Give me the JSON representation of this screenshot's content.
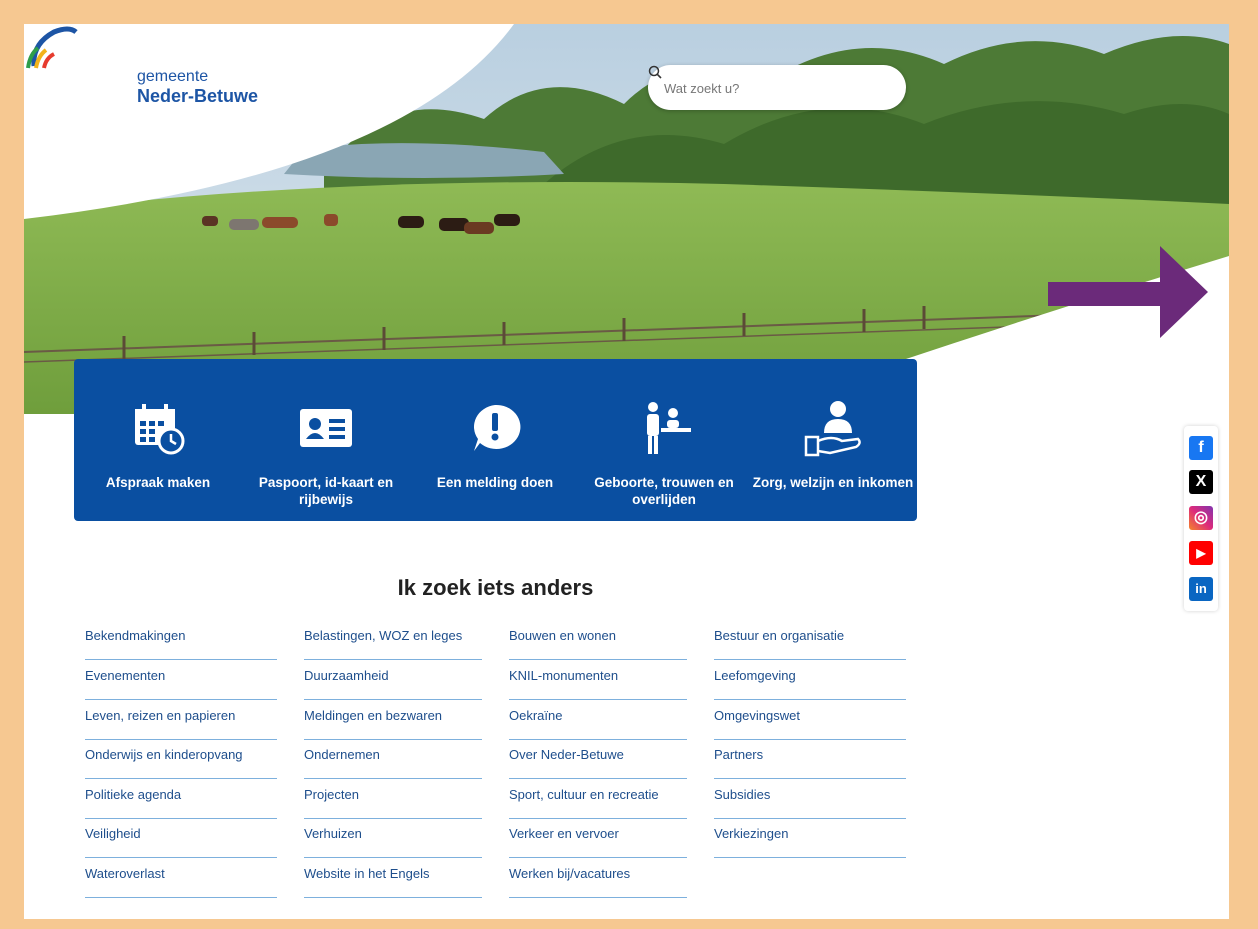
{
  "header": {
    "logo_line1": "gemeente",
    "logo_line2": "Neder-Betuwe",
    "search_placeholder": "Wat zoekt u?"
  },
  "tiles": [
    {
      "label": "Afspraak maken",
      "icon": "calendar-clock-icon"
    },
    {
      "label": "Paspoort, id-kaart en rijbewijs",
      "icon": "id-card-icon"
    },
    {
      "label": "Een melding doen",
      "icon": "exclamation-bubble-icon"
    },
    {
      "label": "Geboorte, trouwen en overlijden",
      "icon": "people-counter-icon"
    },
    {
      "label": "Zorg, welzijn en inkomen",
      "icon": "care-hand-icon"
    }
  ],
  "section": {
    "title": "Ik zoek iets anders",
    "columns": [
      [
        "Bekendmakingen",
        "Evenementen",
        "Leven, reizen en papieren",
        "Onderwijs en kinderopvang",
        "Politieke agenda",
        "Veiligheid",
        "Wateroverlast"
      ],
      [
        "Belastingen, WOZ en leges",
        "Duurzaamheid",
        "Meldingen en bezwaren",
        "Ondernemen",
        "Projecten",
        "Verhuizen",
        "Website in het Engels"
      ],
      [
        "Bouwen en wonen",
        "KNIL-monumenten",
        "Oekraïne",
        "Over Neder-Betuwe",
        "Sport, cultuur en recreatie",
        "Verkeer en vervoer",
        "Werken bij/vacatures"
      ],
      [
        "Bestuur en organisatie",
        "Leefomgeving",
        "Omgevingswet",
        "Partners",
        "Subsidies",
        "Verkiezingen"
      ]
    ]
  },
  "social": [
    {
      "name": "facebook-icon",
      "glyph": "f",
      "color": "#1877f2"
    },
    {
      "name": "x-icon",
      "glyph": "X",
      "color": "#000000"
    },
    {
      "name": "instagram-icon",
      "glyph": "◎",
      "color": "#e1306c"
    },
    {
      "name": "youtube-icon",
      "glyph": "▶",
      "color": "#ff0000"
    },
    {
      "name": "linkedin-icon",
      "glyph": "in",
      "color": "#0a66c2"
    }
  ],
  "colors": {
    "brand_blue": "#0a4fa1",
    "link_text": "#1e4e8c",
    "link_rule": "#7db0dd",
    "frame": "#f6c891",
    "annotation_arrow": "#6b2a7a"
  }
}
